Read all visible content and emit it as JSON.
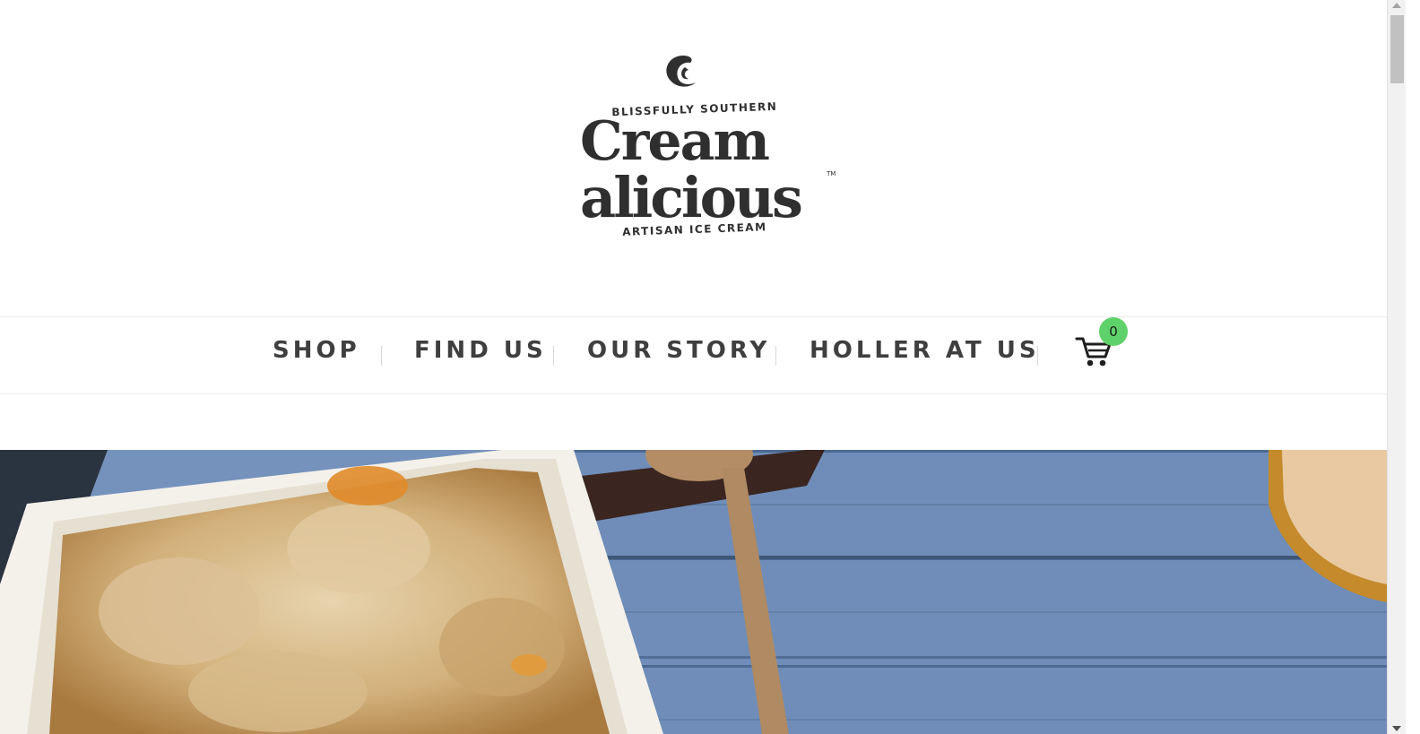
{
  "brand": {
    "tagline_top": "BLISSFULLY SOUTHERN",
    "name_line1": "Cream",
    "name_line2": "alicious",
    "tagline_bottom": "ARTISAN ICE CREAM",
    "trademark": "TM",
    "logo_color": "#2f2f30"
  },
  "nav": {
    "items": [
      {
        "label": "SHOP"
      },
      {
        "label": "FIND US"
      },
      {
        "label": "OUR STORY"
      },
      {
        "label": "HOLLER AT US"
      }
    ],
    "cart_icon": "shopping-cart-icon",
    "cart_count": "0",
    "badge_color": "#5fd16a"
  },
  "hero": {
    "description_icon": "hero-food-photo"
  }
}
